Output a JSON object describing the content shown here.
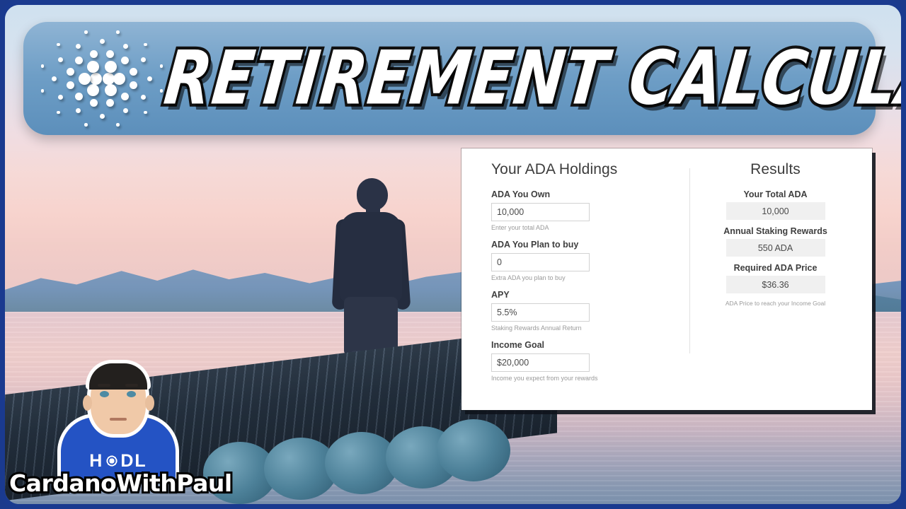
{
  "banner": {
    "title": "RETIREMENT  CALCULATOR",
    "logo_name": "cardano-logo",
    "background_color": "#6e9ec6"
  },
  "calculator": {
    "left": {
      "heading": "Your ADA Holdings",
      "fields": [
        {
          "label": "ADA You Own",
          "value": "10,000",
          "help": "Enter your total ADA"
        },
        {
          "label": "ADA You Plan to buy",
          "value": "0",
          "help": "Extra ADA you plan to buy"
        },
        {
          "label": "APY",
          "value": "5.5%",
          "help": "Staking Rewards Annual Return"
        },
        {
          "label": "Income Goal",
          "value": "$20,000",
          "help": "Income you expect from your rewards"
        }
      ]
    },
    "right": {
      "heading": "Results",
      "results": [
        {
          "label": "Your Total ADA",
          "value": "10,000"
        },
        {
          "label": "Annual Staking Rewards",
          "value": "550 ADA"
        },
        {
          "label": "Required ADA Price",
          "value": "$36.36"
        }
      ],
      "help": "ADA Price to reach your Income Goal"
    }
  },
  "watermark": {
    "channel_name": "CardanoWithPaul",
    "shirt_text_left": "H",
    "shirt_text_right": "DL"
  },
  "photo": {
    "description": "man-standing-on-dock-at-sunset"
  }
}
